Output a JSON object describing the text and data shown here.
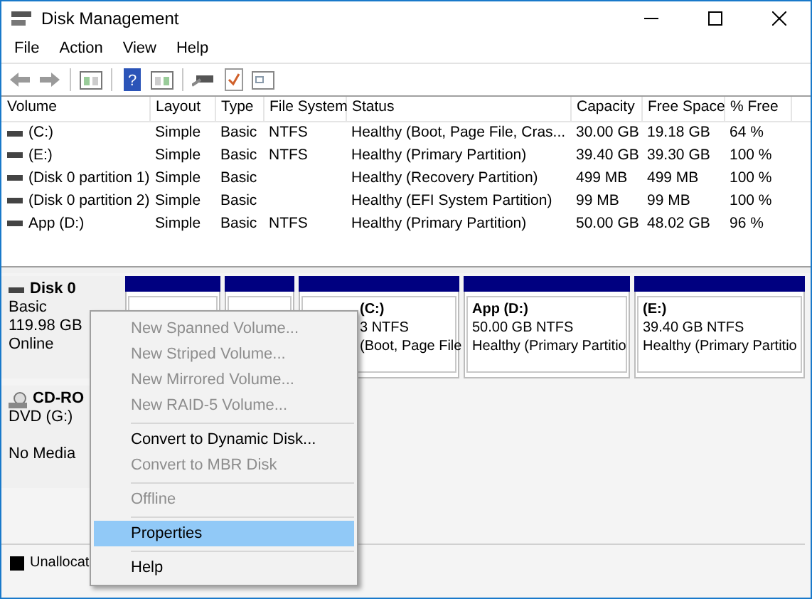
{
  "window": {
    "title": "Disk Management"
  },
  "toolbar": {
    "help_glyph": "?"
  },
  "menu": [
    "File",
    "Action",
    "View",
    "Help"
  ],
  "table": {
    "columns": [
      "Volume",
      "Layout",
      "Type",
      "File System",
      "Status",
      "Capacity",
      "Free Space",
      "% Free"
    ],
    "rows": [
      [
        "(C:)",
        "Simple",
        "Basic",
        "NTFS",
        "Healthy (Boot, Page File, Cras...",
        "30.00 GB",
        "19.18 GB",
        "64 %"
      ],
      [
        "(E:)",
        "Simple",
        "Basic",
        "NTFS",
        "Healthy (Primary Partition)",
        "39.40 GB",
        "39.30 GB",
        "100 %"
      ],
      [
        "(Disk 0 partition 1)",
        "Simple",
        "Basic",
        "",
        "Healthy (Recovery Partition)",
        "499 MB",
        "499 MB",
        "100 %"
      ],
      [
        "(Disk 0 partition 2)",
        "Simple",
        "Basic",
        "",
        "Healthy (EFI System Partition)",
        "99 MB",
        "99 MB",
        "100 %"
      ],
      [
        "App (D:)",
        "Simple",
        "Basic",
        "NTFS",
        "Healthy (Primary Partition)",
        "50.00 GB",
        "48.02 GB",
        "96 %"
      ]
    ]
  },
  "disks": [
    {
      "kind": "disk",
      "name": "Disk 0",
      "lines": [
        "Basic",
        "119.98 GB",
        "Online"
      ],
      "partitions": [
        {
          "kind": "hidden"
        },
        {
          "kind": "hidden"
        },
        {
          "kind": "volume",
          "name": "(C:)",
          "lines": [
            "3 NTFS",
            "(Boot, Page File"
          ]
        },
        {
          "kind": "volume",
          "name": "App  (D:)",
          "lines": [
            "50.00 GB NTFS",
            "Healthy (Primary Partitio"
          ]
        },
        {
          "kind": "volume",
          "name": "(E:)",
          "lines": [
            "39.40 GB NTFS",
            "Healthy (Primary Partitio"
          ]
        }
      ]
    },
    {
      "kind": "cdrom",
      "name": "CD-RO",
      "lines": [
        "DVD (G:)",
        "No Media"
      ]
    }
  ],
  "legend": [
    {
      "label": "Unallocat",
      "color": "#000000"
    }
  ],
  "context_menu": [
    {
      "kind": "item",
      "label": "New Spanned Volume...",
      "disabled": true,
      "selected": false
    },
    {
      "kind": "item",
      "label": "New Striped Volume...",
      "disabled": true,
      "selected": false
    },
    {
      "kind": "item",
      "label": "New Mirrored Volume...",
      "disabled": true,
      "selected": false
    },
    {
      "kind": "item",
      "label": "New RAID-5 Volume...",
      "disabled": true,
      "selected": false
    },
    {
      "kind": "separator"
    },
    {
      "kind": "item",
      "label": "Convert to Dynamic Disk...",
      "disabled": false,
      "selected": false
    },
    {
      "kind": "item",
      "label": "Convert to MBR Disk",
      "disabled": true,
      "selected": false
    },
    {
      "kind": "separator"
    },
    {
      "kind": "item",
      "label": "Offline",
      "disabled": true,
      "selected": false
    },
    {
      "kind": "separator"
    },
    {
      "kind": "item",
      "label": "Properties",
      "disabled": false,
      "selected": true
    },
    {
      "kind": "separator"
    },
    {
      "kind": "item",
      "label": "Help",
      "disabled": false,
      "selected": false
    }
  ]
}
